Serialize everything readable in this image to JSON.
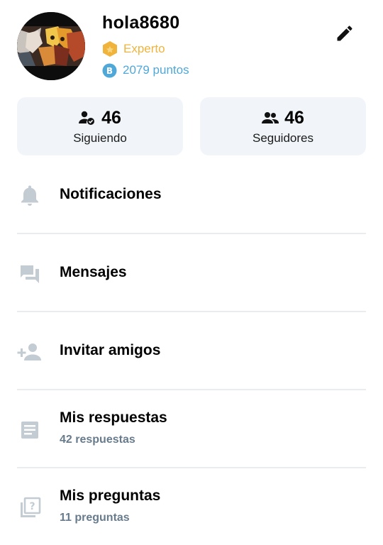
{
  "profile": {
    "username": "hola8680",
    "rank": "Experto",
    "points": "2079 puntos"
  },
  "stats": {
    "following_count": "46",
    "following_label": "Siguiendo",
    "followers_count": "46",
    "followers_label": "Seguidores"
  },
  "menu": [
    {
      "title": "Notificaciones",
      "icon": "bell-icon"
    },
    {
      "title": "Mensajes",
      "icon": "chat-icon"
    },
    {
      "title": "Invitar amigos",
      "icon": "add-person-icon"
    },
    {
      "title": "Mis respuestas",
      "subtitle": "42 respuestas",
      "icon": "document-icon"
    },
    {
      "title": "Mis preguntas",
      "subtitle": "11 preguntas",
      "icon": "question-icon"
    }
  ],
  "colors": {
    "rank": "#f0b43c",
    "points": "#4fa8d8",
    "card_bg": "#f1f5f9",
    "muted_icon": "#c4ccd3",
    "subtitle": "#687b8c"
  }
}
